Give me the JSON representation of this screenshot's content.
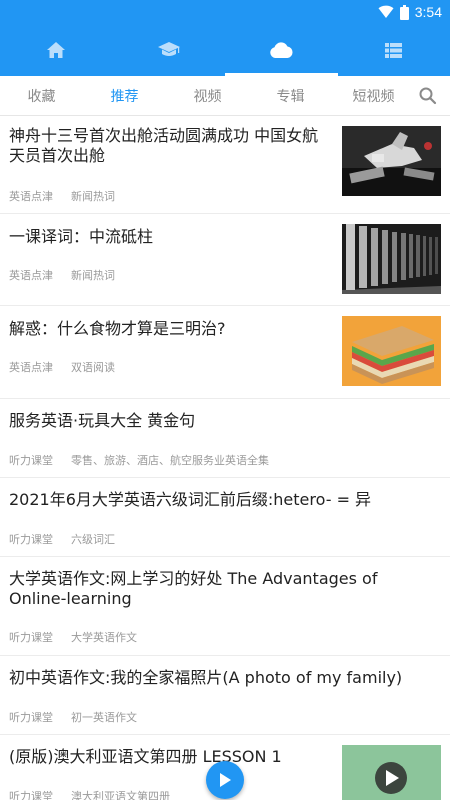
{
  "status_bar": {
    "time": "3:54"
  },
  "top_nav": {
    "tabs": [
      {
        "icon": "home-icon"
      },
      {
        "icon": "graduation-cap-icon"
      },
      {
        "icon": "cloud-icon",
        "active": true
      },
      {
        "icon": "list-icon"
      }
    ]
  },
  "sub_tabs": {
    "items": [
      "收藏",
      "推荐",
      "视频",
      "专辑",
      "短视频"
    ],
    "active": "推荐"
  },
  "feed": [
    {
      "title": "神舟十三号首次出舱活动圆满成功 中国女航天员首次出舱",
      "tags": [
        "英语点津",
        "新闻热词"
      ],
      "thumb": "space-station-image"
    },
    {
      "title": "一课译词：中流砥柱",
      "tags": [
        "英语点津",
        "新闻热词"
      ],
      "thumb": "columns-image"
    },
    {
      "title": "解惑：什么食物才算是三明治?",
      "tags": [
        "英语点津",
        "双语阅读"
      ],
      "thumb": "sandwich-image"
    },
    {
      "title": "服务英语·玩具大全 黄金句",
      "tags": [
        "听力课堂",
        "零售、旅游、酒店、航空服务业英语全集"
      ]
    },
    {
      "title": "2021年6月大学英语六级词汇前后缀:hetero- = 异",
      "tags": [
        "听力课堂",
        "六级词汇"
      ]
    },
    {
      "title": "大学英语作文:网上学习的好处 The Advantages of Online-learning",
      "tags": [
        "听力课堂",
        "大学英语作文"
      ]
    },
    {
      "title": "初中英语作文:我的全家福照片(A photo of my family)",
      "tags": [
        "听力课堂",
        "初一英语作文"
      ]
    },
    {
      "title": "(原版)澳大利亚语文第四册 LESSON 1",
      "tags": [
        "听力课堂",
        "澳大利亚语文第四册"
      ],
      "thumb": "video-thumbnail"
    }
  ],
  "colors": {
    "primary": "#2196f3"
  }
}
